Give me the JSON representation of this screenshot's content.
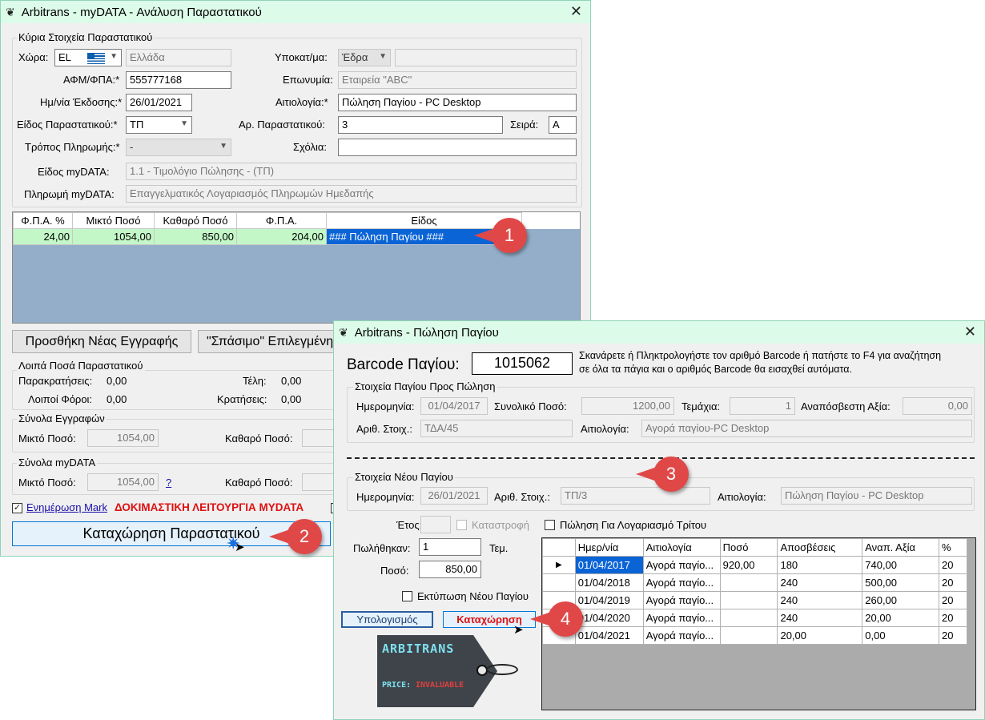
{
  "win1": {
    "title": "Arbitrans - myDATA - Ανάλυση Παραστατικού",
    "main_group": "Κύρια Στοιχεία Παραστατικού",
    "country_label": "Χώρα:",
    "country_code": "EL",
    "country_name": "Ελλάδα",
    "subsidiary_label": "Υποκατ/μα:",
    "subsidiary_value": "Έδρα",
    "vat_label": "ΑΦΜ/ΦΠΑ:*",
    "vat_value": "555777168",
    "name_label": "Επωνυμία:",
    "name_value": "Εταιρεία \"ABC\"",
    "date_label": "Ημ/νία Έκδοσης:*",
    "date_value": "26/01/2021",
    "reason_label": "Αιτιολογία:*",
    "reason_value": "Πώληση Παγίου - PC Desktop",
    "doctype_label": "Είδος Παραστατικού:*",
    "doctype_value": "ΤΠ",
    "docnum_label": "Αρ. Παραστατικού:",
    "docnum_value": "3",
    "series_label": "Σειρά:",
    "series_value": "A",
    "payment_label": "Τρόπος Πληρωμής:*",
    "payment_value": "-",
    "comments_label": "Σχόλια:",
    "mydata_type_label": "Είδος myDATA:",
    "mydata_type_value": "1.1 - Τιμολόγιο Πώλησης - (ΤΠ)",
    "mydata_pay_label": "Πληρωμή myDATA:",
    "mydata_pay_value": "Επαγγελματικός Λογαριασμός Πληρωμών Ημεδαπής",
    "grid_headers": [
      "Φ.Π.Α. %",
      "Μικτό Ποσό",
      "Καθαρό Ποσό",
      "Φ.Π.Α.",
      "Είδος"
    ],
    "grid_row": [
      "24,00",
      "1054,00",
      "850,00",
      "204,00",
      "### Πώληση Παγίου ###"
    ],
    "btn_add": "Προσθήκη Νέας Εγγραφής",
    "btn_split": "\"Σπάσιμο\" Επιλεγμένη",
    "other_group": "Λοιπά Ποσά Παραστατικού",
    "withholding_label": "Παρακρατήσεις:",
    "withholding_value": "0,00",
    "fees_label": "Τέλη:",
    "fees_value": "0,00",
    "othertax_label": "Λοιποί Φόροι:",
    "othertax_value": "0,00",
    "deductions_label": "Κρατήσεις:",
    "deductions_value": "0,00",
    "totals_group": "Σύνολα Εγγραφών",
    "gross_label": "Μικτό Ποσό:",
    "gross_value": "1054,00",
    "net_label": "Καθαρό Ποσό:",
    "mydata_group": "Σύνολα myDATA",
    "gross2_label": "Μικτό Ποσό:",
    "gross2_value": "1054,00",
    "help": "?",
    "net2_label": "Καθαρό Ποσό:",
    "update_mark": "Ενημέρωση Mark",
    "test_mode": "ΔΟΚΙΜΑΣΤΙΚΗ ΛΕΙΤΟΥΡΓΙΑ ΜΥDATA",
    "btn_submit": "Καταχώρηση Παραστατικού"
  },
  "win2": {
    "title": "Arbitrans - Πώληση Παγίου",
    "barcode_label": "Barcode Παγίου:",
    "barcode_value": "1015062",
    "barcode_help_1": "Σκανάρετε ή Πληκτρολογήστε τον αριθμό Barcode ή πατήστε το F4 για αναζήτηση",
    "barcode_help_2": "σε όλα τα πάγια και ο αριθμός Barcode θα εισαχθεί αυτόματα.",
    "asset_group": "Στοιχεία Παγίου Προς Πώληση",
    "a_date_label": "Ημερομηνία:",
    "a_date_value": "01/04/2017",
    "a_total_label": "Συνολικό Ποσό:",
    "a_total_value": "1200,00",
    "a_pieces_label": "Τεμάχια:",
    "a_pieces_value": "1",
    "a_residual_label": "Αναπόσβεστη Αξία:",
    "a_residual_value": "0,00",
    "a_ref_label": "Αριθ. Στοιχ.:",
    "a_ref_value": "ΤΔΑ/45",
    "a_reason_label": "Αιτιολογία:",
    "a_reason_value": "Αγορά παγίου-PC Desktop",
    "new_group": "Στοιχεία Νέου Παγίου",
    "n_date_label": "Ημερομηνία:",
    "n_date_value": "26/01/2021",
    "n_ref_label": "Αριθ. Στοιχ.:",
    "n_ref_value": "ΤΠ/3",
    "n_reason_label": "Αιτιολογία:",
    "n_reason_value": "Πώληση Παγίου - PC Desktop",
    "year_label": "Έτος:",
    "destroy_label": "Καταστροφή",
    "third_party_label": "Πώληση Για Λογαριασμό Τρίτου",
    "sold_label": "Πωλήθηκαν:",
    "sold_value": "1",
    "unit": "Τεμ.",
    "amount_label": "Ποσό:",
    "amount_value": "850,00",
    "print_label": "Εκτύπωση Νέου Παγίου",
    "btn_calc": "Υπολογισμός",
    "btn_save": "Καταχώρηση",
    "logo_text": "ARBITRANS",
    "price_label": "PRICE:",
    "price_value": "INVALUABLE",
    "grid_headers": [
      "Ημερ/νία",
      "Αιτιολογία",
      "Ποσό",
      "Αποσβέσεις",
      "Αναπ. Αξία",
      "%"
    ],
    "grid_rows": [
      [
        "01/04/2017",
        "Αγορά παγίο...",
        "920,00",
        "180",
        "740,00",
        "20"
      ],
      [
        "01/04/2018",
        "Αγορά παγίο...",
        "",
        "240",
        "500,00",
        "20"
      ],
      [
        "01/04/2019",
        "Αγορά παγίο...",
        "",
        "240",
        "260,00",
        "20"
      ],
      [
        "01/04/2020",
        "Αγορά παγίο...",
        "",
        "240",
        "20,00",
        "20"
      ],
      [
        "01/04/2021",
        "Αγορά παγίο...",
        "",
        "20,00",
        "0,00",
        "20"
      ]
    ]
  },
  "callouts": [
    "1",
    "2",
    "3",
    "4"
  ]
}
